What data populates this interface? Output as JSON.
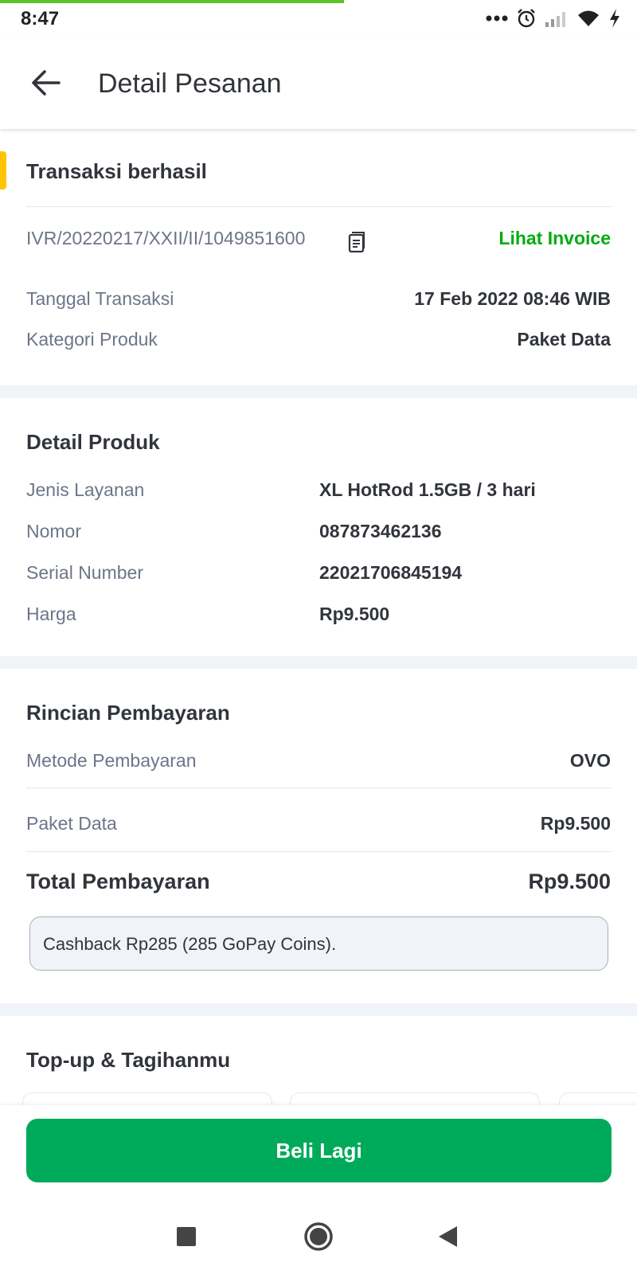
{
  "status_bar": {
    "time": "8:47",
    "load_progress": 0.54,
    "icons": [
      "more-dots-icon",
      "alarm-icon",
      "signal-icon",
      "wifi-icon",
      "charging-icon"
    ]
  },
  "app_bar": {
    "title": "Detail Pesanan",
    "back_icon": "back-arrow-icon"
  },
  "transaction": {
    "status": "Transaksi berhasil",
    "invoice_number": "IVR/20220217/XXII/II/1049851600",
    "invoice_link": "Lihat Invoice",
    "date_label": "Tanggal Transaksi",
    "date_value": "17 Feb 2022 08:46  WIB",
    "category_label": "Kategori Produk",
    "category_value": "Paket Data"
  },
  "product": {
    "title": "Detail Produk",
    "rows": [
      {
        "label": "Jenis Layanan",
        "value": "XL HotRod 1.5GB / 3 hari"
      },
      {
        "label": "Nomor",
        "value": "087873462136"
      },
      {
        "label": "Serial Number",
        "value": "22021706845194"
      },
      {
        "label": "Harga",
        "value": "Rp9.500"
      }
    ]
  },
  "payment": {
    "title": "Rincian Pembayaran",
    "method_label": "Metode Pembayaran",
    "method_value": "OVO",
    "item_label": "Paket Data",
    "item_value": "Rp9.500",
    "total_label": "Total Pembayaran",
    "total_value": "Rp9.500",
    "cashback": "Cashback Rp285 (285 GoPay Coins)."
  },
  "topup": {
    "title": "Top-up & Tagihanmu"
  },
  "actions": {
    "buy_again": "Beli Lagi"
  },
  "colors": {
    "accent_green": "#03ac0e",
    "button_green": "#00aa5b",
    "status_yellow": "#ffc400"
  }
}
